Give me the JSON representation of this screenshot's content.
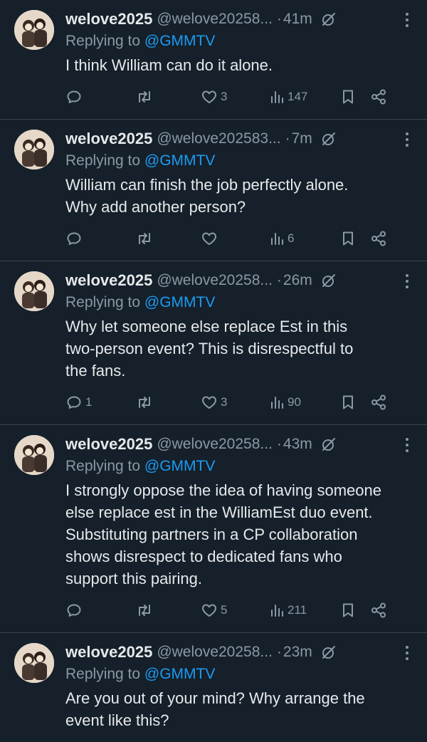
{
  "tweets": [
    {
      "name": "welove2025",
      "handle": "@welove20258...",
      "separator": "·",
      "time": "41m",
      "replying_prefix": "Replying to ",
      "replying_to": "@GMMTV",
      "lines": [
        "I think William can do it alone."
      ],
      "replies": "",
      "retweets": "",
      "likes": "3",
      "views": "147"
    },
    {
      "name": "welove2025",
      "handle": "@welove202583...",
      "separator": "·",
      "time": "7m",
      "replying_prefix": "Replying to ",
      "replying_to": "@GMMTV",
      "lines": [
        "William can finish the job perfectly alone.",
        "Why add another person?"
      ],
      "replies": "",
      "retweets": "",
      "likes": "",
      "views": "6"
    },
    {
      "name": "welove2025",
      "handle": "@welove20258...",
      "separator": "·",
      "time": "26m",
      "replying_prefix": "Replying to ",
      "replying_to": "@GMMTV",
      "lines": [
        "Why let someone else replace Est in this",
        "two-person event? This is disrespectful to",
        "the fans."
      ],
      "replies": "1",
      "retweets": "",
      "likes": "3",
      "views": "90"
    },
    {
      "name": "welove2025",
      "handle": "@welove20258...",
      "separator": "·",
      "time": "43m",
      "replying_prefix": "Replying to ",
      "replying_to": "@GMMTV",
      "lines": [
        "I strongly oppose the idea of having someone",
        "else replace est in the WilliamEst duo event.",
        "Substituting partners in a CP collaboration",
        "shows disrespect to dedicated fans who",
        "support this pairing."
      ],
      "replies": "",
      "retweets": "",
      "likes": "5",
      "views": "211"
    },
    {
      "name": "welove2025",
      "handle": "@welove20258...",
      "separator": "·",
      "time": "23m",
      "replying_prefix": "Replying to ",
      "replying_to": "@GMMTV",
      "lines": [
        "Are you out of your mind? Why arrange the",
        "event like this?"
      ],
      "replies": "",
      "retweets": "",
      "likes": "",
      "views": ""
    }
  ],
  "icons": {
    "reply": "reply-icon",
    "retweet": "retweet-icon",
    "like": "heart-icon",
    "views": "views-icon",
    "bookmark": "bookmark-icon",
    "share": "share-icon",
    "grok": "grok-icon",
    "more": "more-icon"
  },
  "colors": {
    "background": "#15202b",
    "text": "#e7e9ea",
    "muted": "#8b98a5",
    "accent": "#1d9bf0",
    "divider": "#38444d"
  }
}
